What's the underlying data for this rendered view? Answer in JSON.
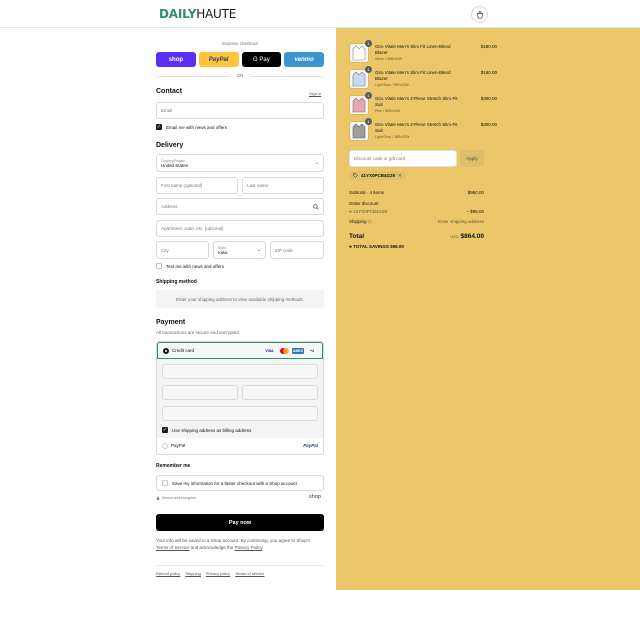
{
  "brand": {
    "part1": "DAILY",
    "part2": "HAUTE"
  },
  "header": {
    "cart_icon": "shopping-bag-icon"
  },
  "express": {
    "label": "Express checkout",
    "buttons": [
      "shop",
      "PayPal",
      "G Pay",
      "venmo"
    ],
    "or": "OR"
  },
  "contact": {
    "title": "Contact",
    "signin": "Sign in",
    "email_placeholder": "Email",
    "news_label": "Email me with news and offers",
    "news_checked": true
  },
  "delivery": {
    "title": "Delivery",
    "country_label": "Country/Region",
    "country_value": "United States",
    "first_name": "First name (optional)",
    "last_name": "Last name",
    "address": "Address",
    "apartment": "Apartment, suite, etc. (optional)",
    "city": "City",
    "state_label": "State",
    "state_value": "Iowa",
    "zip": "ZIP code",
    "text_label": "Text me with news and offers"
  },
  "shipping": {
    "title": "Shipping method",
    "message": "Enter your shipping address to view available shipping methods."
  },
  "payment": {
    "title": "Payment",
    "subtitle": "All transactions are secure and encrypted.",
    "credit_card": "Credit card",
    "card_brands": [
      "VISA",
      "MC",
      "AMEX",
      "+4"
    ],
    "billing_label": "Use shipping address as billing address",
    "paypal_label": "PayPal",
    "paypal_logo": "PayPal"
  },
  "remember": {
    "title": "Remember me",
    "save_label": "Save my information for a faster checkout with a Shop account",
    "secure": "Secure and encrypted",
    "shop": "shop"
  },
  "paynow": "Pay now",
  "legal": {
    "line1": "Your info will be saved to a Shop account. By continuing, you agree to Shop's",
    "terms": "Terms of Service",
    "and": " and acknowledge the ",
    "privacy": "Privacy Policy",
    "end": "."
  },
  "footer": [
    "Refund policy",
    "Shipping",
    "Privacy policy",
    "Terms of service"
  ],
  "summary": {
    "items": [
      {
        "qty": "1",
        "name": "Giro Vitale Men's Slim Fit Linen-Blend Blazer",
        "variant": "White / 38Rx32W",
        "price": "$180.00",
        "color": "#ffffff"
      },
      {
        "qty": "1",
        "name": "Giro Vitale Men's Slim Fit Linen-Blend Blazer",
        "variant": "Light Blue / 38Rx32W",
        "price": "$180.00",
        "color": "#c9d9ef"
      },
      {
        "qty": "1",
        "name": "Giro Vitale Men's 2-Piece Stretch Slim-Fit Suit",
        "variant": "Pink / 38Rx32W",
        "price": "$300.00",
        "color": "#e8a6b0"
      },
      {
        "qty": "1",
        "name": "Giro Vitale Men's 2-Piece Stretch Slim-Fit Suit",
        "variant": "Light Grey / 38Rx32W",
        "price": "$300.00",
        "color": "#9e9e9e"
      }
    ],
    "discount_placeholder": "Discount code or gift card",
    "apply": "Apply",
    "code": "41YX0PCB4G29",
    "subtotal_label": "Subtotal · 4 items",
    "subtotal": "$960.00",
    "order_discount": "Order discount",
    "discount_code": "41YX0PCB4G29",
    "discount_value": "− $96.00",
    "shipping_label": "Shipping",
    "shipping_value": "Enter shipping address",
    "total_label": "Total",
    "currency": "USD",
    "total": "$864.00",
    "savings_label": "TOTAL SAVINGS",
    "savings": "$96.00"
  }
}
